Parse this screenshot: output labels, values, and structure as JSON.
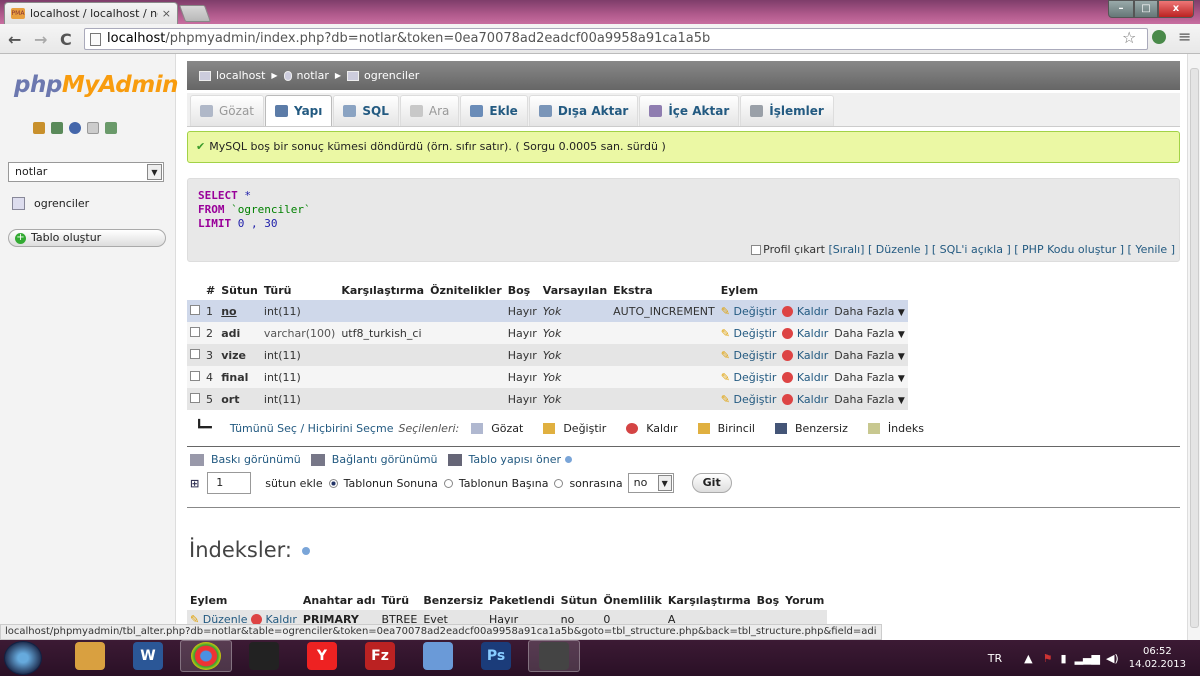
{
  "browser": {
    "tab_title": "localhost / localhost / not",
    "tab_close": "×",
    "favicon_text": "PMA",
    "url_host": "localhost",
    "url_path": "/phpmyadmin/index.php?db=notlar&token=0ea70078ad2eadcf00a9958a91ca1a5b",
    "back": "←",
    "forward": "→",
    "reload": "C",
    "star": "☆",
    "menu": "≡",
    "win_min": "–",
    "win_max": "□",
    "win_close": "x"
  },
  "sidebar": {
    "logo_php": "php",
    "logo_myadmin": "MyAdmin",
    "db_select": "notlar",
    "table_item": "ogrenciler",
    "create_table": "Tablo oluştur"
  },
  "breadcrumb": {
    "server": "localhost",
    "db": "notlar",
    "table": "ogrenciler",
    "sep": "▶"
  },
  "tabs": [
    {
      "label": "Gözat",
      "state": "dis",
      "color": "#b0b8c8"
    },
    {
      "label": "Yapı",
      "state": "act",
      "color": "#5c7ca8"
    },
    {
      "label": "SQL",
      "state": "",
      "color": "#8aa3c2"
    },
    {
      "label": "Ara",
      "state": "dis",
      "color": "#c8c8c8"
    },
    {
      "label": "Ekle",
      "state": "",
      "color": "#6a8cb8"
    },
    {
      "label": "Dışa Aktar",
      "state": "",
      "color": "#7a95b8"
    },
    {
      "label": "İçe Aktar",
      "state": "",
      "color": "#8f7db0"
    },
    {
      "label": "İşlemler",
      "state": "",
      "color": "#9aa0a8"
    }
  ],
  "message": {
    "check": "✔",
    "text": "MySQL boş bir sonuç kümesi döndürdü (örn. sıfır satır). ( Sorgu 0.0005 san. sürdü )"
  },
  "sql": {
    "select_kw": "SELECT",
    "star": "*",
    "from_kw": "FROM",
    "table": "`ogrenciler`",
    "limit_kw": "LIMIT",
    "limit_val": "0 , 30"
  },
  "sql_links": {
    "profile": "Profil çıkart",
    "links": [
      "[Sıralı]",
      "[ Düzenle ]",
      "[ SQL'i açıkla ]",
      "[ PHP Kodu oluştur ]",
      "[ Yenile ]"
    ]
  },
  "structure": {
    "headers": [
      "#",
      "Sütun",
      "Türü",
      "Karşılaştırma",
      "Öznitelikler",
      "Boş",
      "Varsayılan",
      "Ekstra",
      "Eylem"
    ],
    "rows": [
      {
        "n": "1",
        "name": "no",
        "type": "int(11)",
        "coll": "",
        "attr": "",
        "null": "Hayır",
        "def": "Yok",
        "extra": "AUTO_INCREMENT"
      },
      {
        "n": "2",
        "name": "adi",
        "type": "varchar(100)",
        "coll": "utf8_turkish_ci",
        "attr": "",
        "null": "Hayır",
        "def": "Yok",
        "extra": ""
      },
      {
        "n": "3",
        "name": "vize",
        "type": "int(11)",
        "coll": "",
        "attr": "",
        "null": "Hayır",
        "def": "Yok",
        "extra": ""
      },
      {
        "n": "4",
        "name": "final",
        "type": "int(11)",
        "coll": "",
        "attr": "",
        "null": "Hayır",
        "def": "Yok",
        "extra": ""
      },
      {
        "n": "5",
        "name": "ort",
        "type": "int(11)",
        "coll": "",
        "attr": "",
        "null": "Hayır",
        "def": "Yok",
        "extra": ""
      }
    ],
    "action_change": "Değiştir",
    "action_drop": "Kaldır",
    "action_more": "Daha Fazla"
  },
  "bulk": {
    "select_all": "Tümünü Seç / Hiçbirini Seçme",
    "selected": "Seçilenleri:",
    "actions": [
      {
        "label": "Gözat",
        "color": "#b0b8d0"
      },
      {
        "label": "Değiştir",
        "color": "#e0b040"
      },
      {
        "label": "Kaldır",
        "color": "#d44444"
      },
      {
        "label": "Birincil",
        "color": "#e0b040"
      },
      {
        "label": "Benzersiz",
        "color": "#445577"
      },
      {
        "label": "İndeks",
        "color": "#c8c890"
      }
    ]
  },
  "views": {
    "print": "Baskı görünümü",
    "relation": "Bağlantı görünümü",
    "propose": "Tablo yapısı öner"
  },
  "add_columns": {
    "count": "1",
    "label": "sütun ekle",
    "end": "Tablonun Sonuna",
    "start": "Tablonun Başına",
    "after": "sonrasına",
    "after_col": "no",
    "go": "Git"
  },
  "indexes": {
    "title": "İndeksler:",
    "headers": [
      "Eylem",
      "Anahtar adı",
      "Türü",
      "Benzersiz",
      "Paketlendi",
      "Sütun",
      "Önemlilik",
      "Karşılaştırma",
      "Boş",
      "Yorum"
    ],
    "row": [
      "Düzenle",
      "Kaldır",
      "PRIMARY",
      "BTREE",
      "Evet",
      "Hayır",
      "no",
      "0",
      "A",
      "",
      ""
    ]
  },
  "status_url": "localhost/phpmyadmin/tbl_alter.php?db=notlar&table=ogrenciler&token=0ea70078ad2eadcf00a9958a91ca1a5b&goto=tbl_structure.php&back=tbl_structure.php&field=adi",
  "taskbar": {
    "lang": "TR",
    "time": "06:52",
    "date": "14.02.2013",
    "apps": [
      "",
      "W",
      "",
      "",
      "Y",
      "Fz",
      "",
      "Ps",
      ""
    ]
  }
}
